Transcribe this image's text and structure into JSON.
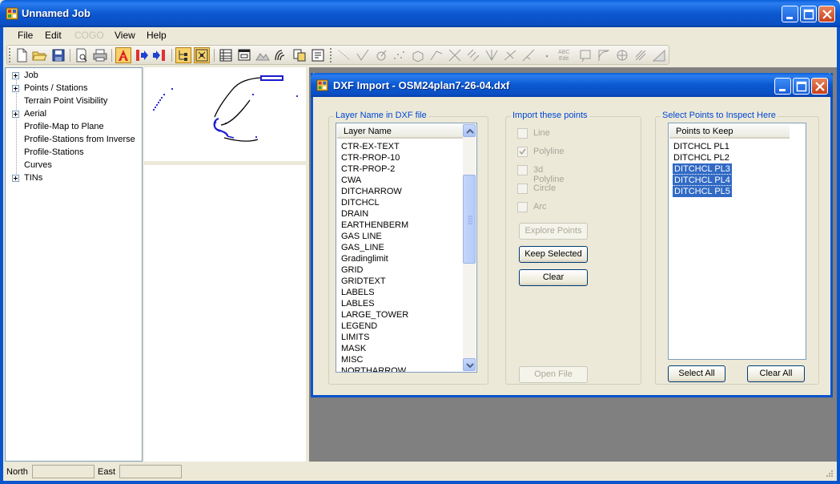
{
  "window": {
    "title": "Unnamed Job"
  },
  "menu": [
    "File",
    "Edit",
    "COGO",
    "View",
    "Help"
  ],
  "tree": [
    {
      "label": "Job",
      "expandable": true
    },
    {
      "label": "Points / Stations",
      "expandable": true
    },
    {
      "label": "Terrain Point Visibility",
      "expandable": false
    },
    {
      "label": "Aerial",
      "expandable": true
    },
    {
      "label": "Profile-Map to Plane",
      "expandable": false
    },
    {
      "label": "Profile-Stations from Inverse",
      "expandable": false
    },
    {
      "label": "Profile-Stations",
      "expandable": false
    },
    {
      "label": "Curves",
      "expandable": false
    },
    {
      "label": "TINs",
      "expandable": true
    }
  ],
  "statusbar": {
    "north_label": "North",
    "north_value": "",
    "east_label": "East",
    "east_value": ""
  },
  "dialog": {
    "title": "DXF Import - OSM24plan7-26-04.dxf",
    "layer_group_label": "Layer Name in DXF file",
    "layer_column": "Layer Name",
    "layers": [
      "CTR-EX-TEXT",
      "CTR-PROP-10",
      "CTR-PROP-2",
      "CWA",
      "DITCHARROW",
      "DITCHCL",
      "DRAIN",
      "EARTHENBERM",
      "GAS LINE",
      "GAS_LINE",
      "Gradinglimit",
      "GRID",
      "GRIDTEXT",
      "LABELS",
      "LABLES",
      "LARGE_TOWER",
      "LEGEND",
      "LIMITS",
      "MASK",
      "MISC",
      "NORTHARROW"
    ],
    "import_group_label": "Import these points",
    "import_options": [
      {
        "label": "Line",
        "checked": false
      },
      {
        "label": "Polyline",
        "checked": true
      },
      {
        "label": "3d Polyline",
        "checked": false
      },
      {
        "label": "Circle",
        "checked": false
      },
      {
        "label": "Arc",
        "checked": false
      }
    ],
    "explore_points": "Explore Points",
    "keep_selected": "Keep Selected",
    "clear": "Clear",
    "open_file": "Open File",
    "inspect_group_label": "Select Points to Inspect Here",
    "points_column": "Points to Keep",
    "points": [
      {
        "label": "DITCHCL PL1",
        "selected": false
      },
      {
        "label": "DITCHCL PL2",
        "selected": false
      },
      {
        "label": "DITCHCL PL3",
        "selected": true
      },
      {
        "label": "DITCHCL PL4",
        "selected": true
      },
      {
        "label": "DITCHCL PL5",
        "selected": true
      }
    ],
    "select_all": "Select  All",
    "clear_all": "Clear All"
  }
}
